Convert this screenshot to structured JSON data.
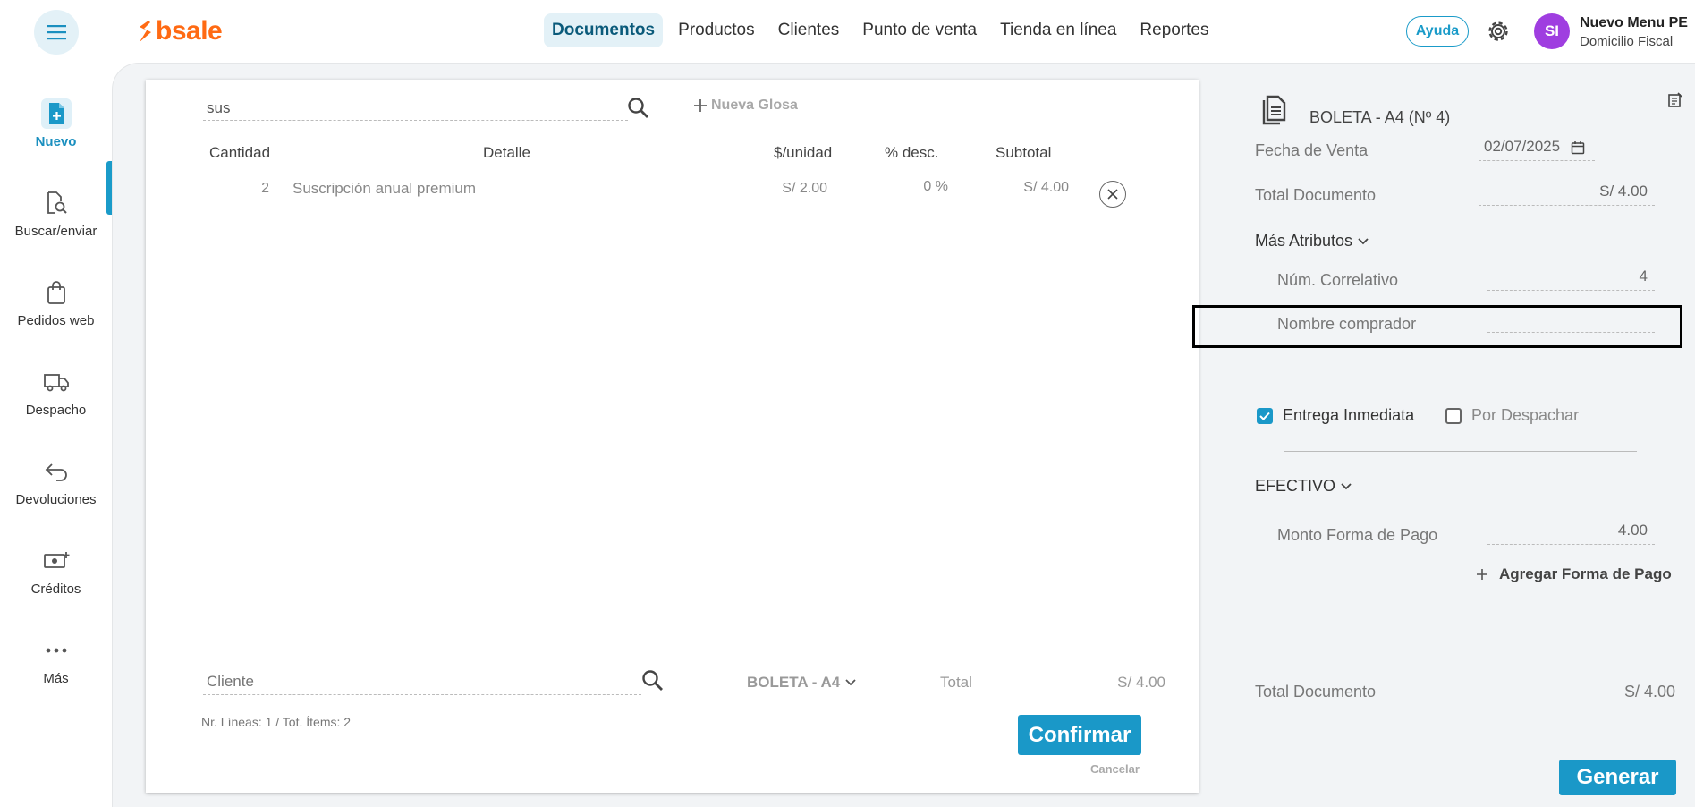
{
  "header": {
    "logo_text": "bsale",
    "nav": [
      {
        "label": "Documentos",
        "active": true
      },
      {
        "label": "Productos"
      },
      {
        "label": "Clientes"
      },
      {
        "label": "Punto de venta"
      },
      {
        "label": "Tienda en línea"
      },
      {
        "label": "Reportes"
      }
    ],
    "help_label": "Ayuda",
    "avatar_initials": "SI",
    "user_name": "Nuevo Menu PE",
    "user_subtitle": "Domicilio Fiscal"
  },
  "sidebar": {
    "items": [
      {
        "label": "Nuevo",
        "icon": "new-document-icon",
        "active": true
      },
      {
        "label": "Buscar/enviar",
        "icon": "search-document-icon"
      },
      {
        "label": "Pedidos web",
        "icon": "shopping-bag-icon"
      },
      {
        "label": "Despacho",
        "icon": "truck-icon"
      },
      {
        "label": "Devoluciones",
        "icon": "return-arrow-icon"
      },
      {
        "label": "Créditos",
        "icon": "money-add-icon"
      },
      {
        "label": "Más",
        "icon": "more-dots-icon"
      }
    ]
  },
  "document": {
    "search_value": "sus",
    "nueva_glosa_label": "Nueva Glosa",
    "columns": {
      "cantidad": "Cantidad",
      "detalle": "Detalle",
      "precio": "$/unidad",
      "descuento": "% desc.",
      "subtotal": "Subtotal"
    },
    "rows": [
      {
        "qty": "2",
        "detail": "Suscripción anual premium",
        "price": "S/ 2.00",
        "discount": "0 %",
        "subtotal": "S/ 4.00"
      }
    ],
    "client_placeholder": "Cliente",
    "doc_type": "BOLETA - A4",
    "total_label": "Total",
    "total_value": "S/ 4.00",
    "lines_info": "Nr. Líneas: 1 / Tot. Ítems: 2",
    "confirm_label": "Confirmar",
    "cancel_label": "Cancelar"
  },
  "summary": {
    "title": "BOLETA - A4 (Nº 4)",
    "fecha_label": "Fecha de Venta",
    "fecha_value": "02/07/2025",
    "total_doc_label": "Total Documento",
    "total_doc_value": "S/ 4.00",
    "mas_atributos_label": "Más Atributos",
    "correlativo_label": "Núm. Correlativo",
    "correlativo_value": "4",
    "comprador_label": "Nombre comprador",
    "comprador_value": "",
    "entrega_label": "Entrega Inmediata",
    "despachar_label": "Por Despachar",
    "payment_method": "EFECTIVO",
    "monto_label": "Monto Forma de Pago",
    "monto_value": "4.00",
    "add_payment_label": "Agregar Forma de Pago",
    "footer_total_label": "Total Documento",
    "footer_total_value": "S/ 4.00",
    "generar_label": "Generar"
  },
  "colors": {
    "brand_orange": "#ff6a13",
    "accent_blue": "#1a98c8",
    "avatar_purple": "#9f3ee0"
  }
}
